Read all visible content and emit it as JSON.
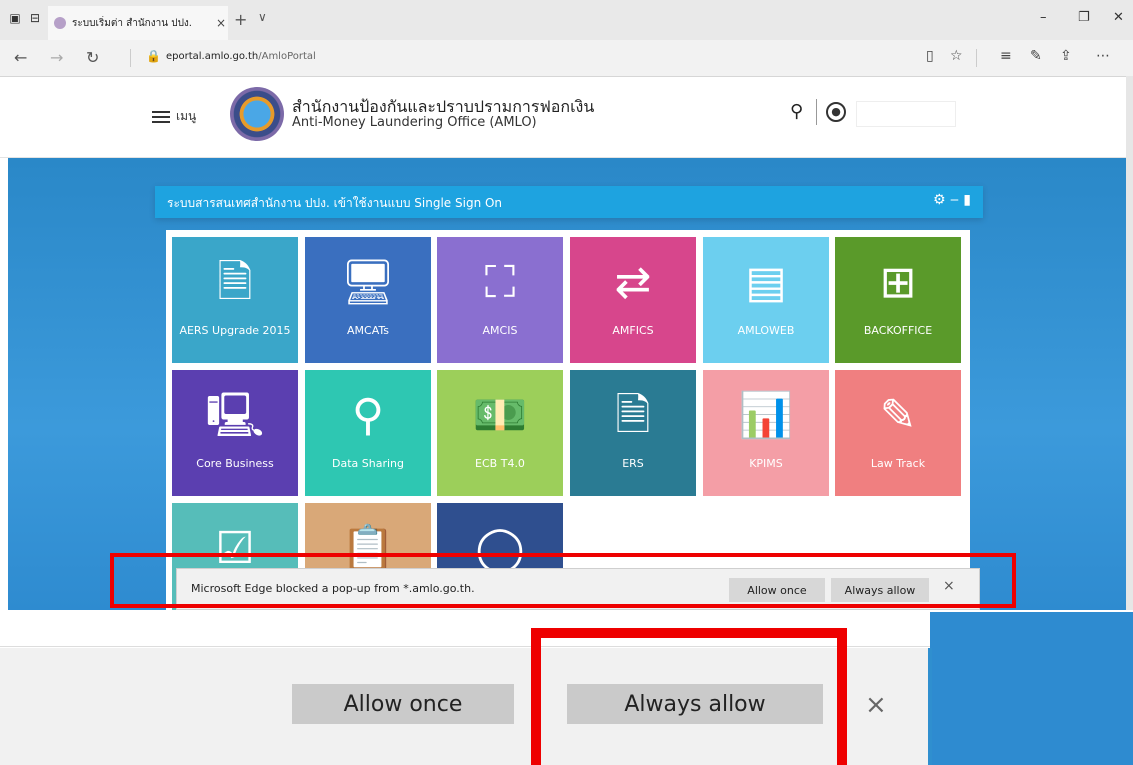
{
  "browser": {
    "tab_title": "ระบบเริ่มต่า สำนักงาน ปปง.",
    "tab_close": "×",
    "new_tab": "+",
    "tab_menu": "∨",
    "url_domain": "eportal.amlo.go.th",
    "url_path": "/AmloPortal"
  },
  "site": {
    "menu_label": "เมนู",
    "title_th": "สำนักงานป้องกันและปราบปรามการฟอกเงิน",
    "title_en": "Anti-Money Laundering Office (AMLO)"
  },
  "panel": {
    "title": "ระบบสารสนเทศสำนักงาน ปปง. เข้าใช้งานแบบ Single Sign On",
    "icons": "⚙ ‒ ▮"
  },
  "tiles": [
    {
      "label": "AERS Upgrade 2015",
      "icon": "document-13-icon",
      "color": "#3aa6c9"
    },
    {
      "label": "AMCATs",
      "icon": "monitor-card-icon",
      "color": "#3a6fbf"
    },
    {
      "label": "AMCIS",
      "icon": "face-scan-icon",
      "color": "#8a6fd0"
    },
    {
      "label": "AMFICS",
      "icon": "document-transfer-icon",
      "color": "#d7468c"
    },
    {
      "label": "AMLOWEB",
      "icon": "document-icon",
      "color": "#6ccfef"
    },
    {
      "label": "BACKOFFICE",
      "icon": "windows-grid-icon",
      "color": "#5a9a2a"
    },
    {
      "label": "Core Business",
      "icon": "org-chart-monitor-icon",
      "color": "#5b3fb0"
    },
    {
      "label": "Data Sharing",
      "icon": "magnifier-icon",
      "color": "#2ec7b2"
    },
    {
      "label": "ECB T4.0",
      "icon": "money-exchange-icon",
      "color": "#9ccf5a"
    },
    {
      "label": "ERS",
      "icon": "document-16-icon",
      "color": "#2a7b93"
    },
    {
      "label": "KPIMS",
      "icon": "presentation-icon",
      "color": "#f49ea6"
    },
    {
      "label": "Law Track",
      "icon": "edit-window-icon",
      "color": "#f07f80"
    },
    {
      "label": "",
      "icon": "checklist-icon",
      "color": "#56bdb9"
    },
    {
      "label": "",
      "icon": "clipboard-icon",
      "color": "#d9a878"
    },
    {
      "label": "",
      "icon": "circle-icon",
      "color": "#2f4f8f"
    }
  ],
  "popup": {
    "message": "Microsoft Edge blocked a pop-up from *.amlo.go.th.",
    "allow_once": "Allow once",
    "always_allow": "Always allow",
    "close": "×"
  }
}
